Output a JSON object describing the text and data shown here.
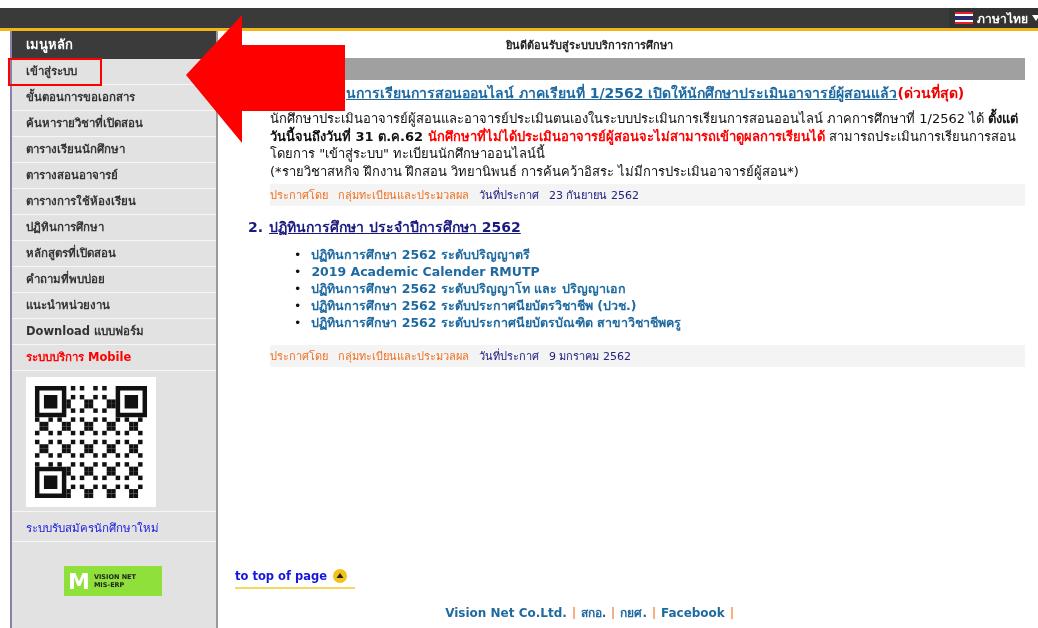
{
  "language": {
    "label": "ภาษาไทย"
  },
  "sidebar": {
    "title": "เมนูหลัก",
    "items": [
      {
        "label": "เข้าสู่ระบบ",
        "kind": "link",
        "highlighted": true
      },
      {
        "label": "ขั้นตอนการขอเอกสาร",
        "kind": "link",
        "highlighted": false
      },
      {
        "label": "ค้นหารายวิชาที่เปิดสอน",
        "kind": "link",
        "highlighted": false
      },
      {
        "label": "ตารางเรียนนักศึกษา",
        "kind": "link",
        "highlighted": false
      },
      {
        "label": "ตารางสอนอาจารย์",
        "kind": "link",
        "highlighted": false
      },
      {
        "label": "ตารางการใช้ห้องเรียน",
        "kind": "link",
        "highlighted": false
      },
      {
        "label": "ปฏิทินการศึกษา",
        "kind": "link",
        "highlighted": false
      },
      {
        "label": "หลักสูตรที่เปิดสอน",
        "kind": "link",
        "highlighted": false
      },
      {
        "label": "คำถามที่พบบ่อย",
        "kind": "link",
        "highlighted": false
      },
      {
        "label": "แนะนำหน่วยงาน",
        "kind": "link",
        "highlighted": false
      },
      {
        "label": "Download แบบฟอร์ม",
        "kind": "link",
        "highlighted": false
      },
      {
        "label": "ระบบบริการ Mobile",
        "kind": "alert",
        "highlighted": false
      },
      {
        "kind": "qr"
      },
      {
        "label": "ระบบรับสมัครนักศึกษาใหม่",
        "kind": "blue",
        "highlighted": false
      },
      {
        "kind": "logo",
        "letter": "M",
        "line1": "VISION NET",
        "line2": "MIS-ERP"
      }
    ]
  },
  "welcome": "ยินดีต้อนรับสู่ระบบบริการการศึกษา",
  "news": [
    {
      "title": "นการเรียนการสอนออนไลน์ ภาคเรียนที่ 1/2562 เปิดให้นักศึกษาประเมินอาจารย์ผู้สอนแล้ว",
      "tag": "(ด่วนที่สุด)",
      "covered": true,
      "body": [
        {
          "text": "นักศึกษาประเมินอาจารย์ผู้สอนและอาจารย์ประเมินตนเองในระบบประเมินการเรียนการสอนออนไลน์ ภาคการศึกษาที่ 1/2562 ได้ ",
          "kind": "normal"
        },
        {
          "text": "ตั้งแต่วันนี้จนถึงวันที่ 31 ต.ค.62 ",
          "kind": "bold"
        },
        {
          "text": "นักศึกษาที่ไม่ได้ประเมินอาจารย์ผู้สอนจะไม่สามารถเข้าดูผลการเรียนได้",
          "kind": "alert"
        },
        {
          "text": " สามารถประเมินการเรียนการสอนโดยการ \"เข้าสู่ระบบ\" ทะเบียนนักศึกษาออนไลน์นี้",
          "kind": "normal"
        },
        {
          "text": "(*รายวิชาสหกิจ ฝึกงาน ฝึกสอน วิทยานิพนธ์ การค้นคว้าอิสระ ไม่มีการประเมินอาจารย์ผู้สอน*)",
          "kind": "break"
        }
      ],
      "by_label": "ประกาศโดย",
      "by": "กลุ่มทะเบียนและประมวลผล",
      "date_label": "วันที่ประกาศ",
      "date": "23 กันยายน 2562"
    },
    {
      "number": "2.",
      "title": "ปฏิทินการศึกษา ประจำปีการศึกษา 2562",
      "covered": false,
      "links": [
        {
          "bullet": "•",
          "label": "ปฏิทินการศึกษา 2562 ระดับปริญญาตรี"
        },
        {
          "bullet": "•",
          "label": "2019 Academic Calender RMUTP"
        },
        {
          "bullet": "•",
          "label": "ปฏิทินการศึกษา 2562 ระดับปริญญาโท และ ปริญญาเอก"
        },
        {
          "bullet": "•",
          "label": "ปฏิทินการศึกษา 2562 ระดับประกาศนียบัตรวิชาชีพ (ปวช.)"
        },
        {
          "bullet": "•",
          "label": "ปฏิทินการศึกษา 2562 ระดับประกาศนียบัตรบัณฑิต สาขาวิชาชีพครู"
        }
      ],
      "by_label": "ประกาศโดย",
      "by": "กลุ่มทะเบียนและประมวลผล",
      "date_label": "วันที่ประกาศ",
      "date": "9 มกราคม 2562"
    }
  ],
  "to_top": "to top of page",
  "footer": [
    "Vision Net Co.Ltd.",
    "สกอ.",
    "กยศ.",
    "Facebook"
  ]
}
